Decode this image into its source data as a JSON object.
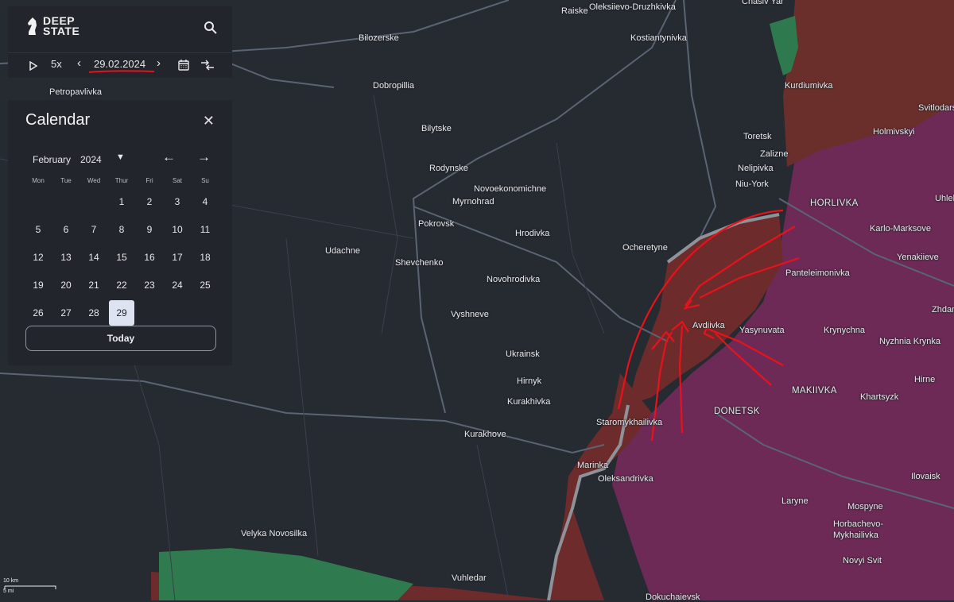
{
  "app": {
    "brand_line1": "DEEP",
    "brand_line2": "STATE",
    "search_icon": "search-icon"
  },
  "controls": {
    "speed": "5x",
    "date": "29.02.2024"
  },
  "calendar": {
    "title": "Calendar",
    "month": "February",
    "year": "2024",
    "weekdays": [
      "Mon",
      "Tue",
      "Wed",
      "Thur",
      "Fri",
      "Sat",
      "Su"
    ],
    "selected_day": "29",
    "today_label": "Today",
    "days": [
      "1",
      "2",
      "3",
      "4",
      "5",
      "6",
      "7",
      "8",
      "9",
      "10",
      "11",
      "12",
      "13",
      "14",
      "15",
      "16",
      "17",
      "18",
      "19",
      "20",
      "21",
      "22",
      "23",
      "24",
      "25",
      "26",
      "27",
      "28",
      "29"
    ]
  },
  "map": {
    "towns": {
      "raiske": "Raiske",
      "oleksiievo": "Oleksiievo-Druzhkivka",
      "chasiv": "Chasiv Yar",
      "bilozerske": "Bilozerske",
      "kostiantynivka": "Kostiantynivka",
      "dobropillia": "Dobropillia",
      "kurdiumivka": "Kurdiumivka",
      "svitlodarsk": "Svitlodarsk",
      "petropavlivka": "Petropavlivka",
      "bilytske": "Bilytske",
      "holmivskyi": "Holmivskyi",
      "toretsk": "Toretsk",
      "zalizne": "Zalizne",
      "nelipivka": "Nelipivka",
      "rodynske": "Rodynske",
      "novoekonomichne": "Novoekonomichne",
      "niuyork": "Niu-York",
      "myrnohrad": "Myrnohrad",
      "horlivka": "HORLIVKA",
      "uhlehirsk": "Uhlehirsk",
      "pokrovsk": "Pokrovsk",
      "hrodivka": "Hrodivka",
      "karlo": "Karlo-Marksove",
      "udachne": "Udachne",
      "ocheretyne": "Ocheretyne",
      "yenakiieve": "Yenakiieve",
      "shevchenko": "Shevchenko",
      "panteleimonivka": "Panteleimonivka",
      "novohrodivka": "Novohrodivka",
      "vyshneve": "Vyshneve",
      "avdiivka": "Avdiivka",
      "yasynuvata": "Yasynuvata",
      "krynychna": "Krynychna",
      "zhdanivka": "Zhdanivka",
      "nyzhnia": "Nyzhnia Krynka",
      "ukrainsk": "Ukrainsk",
      "hirnyk": "Hirnyk",
      "hirne": "Hirne",
      "makiivka": "MAKIIVKA",
      "kurakhivka": "Kurakhivka",
      "khartsyzk": "Khartsyzk",
      "donetsk": "DONETSK",
      "staromykhailivka": "Staromykhailivka",
      "kurakhove": "Kurakhove",
      "marinka": "Marinka",
      "oleksandrivka": "Oleksandrivka",
      "ilovaisk": "Ilovaisk",
      "laryne": "Laryne",
      "mospyne": "Mospyne",
      "horbachevo": "Horbachevo-",
      "mykhailivka": "Mykhailivka",
      "velyka": "Velyka Novosilka",
      "vuhledar": "Vuhledar",
      "novyisvit": "Novyi Svit",
      "dokuchaievsk": "Dokuchaievsk"
    },
    "scale_km": "10 km",
    "scale_mi": "5 mi",
    "colors": {
      "occupied": "#7a2f5a",
      "recent_gain": "#6e2a2a",
      "liberated": "#2f7a4f",
      "background": "#262a31",
      "arrows": "#e8121b"
    }
  }
}
